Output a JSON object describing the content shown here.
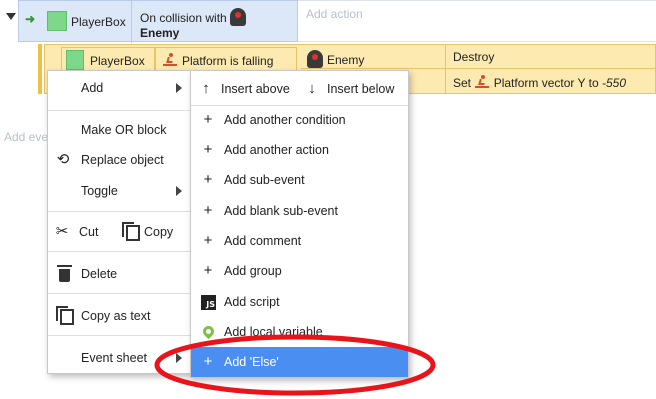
{
  "event": {
    "object": "PlayerBox",
    "condition_line1": "On collision with",
    "condition_line2": "Enemy",
    "add_action": "Add action"
  },
  "sub_event": {
    "object": "PlayerBox",
    "condition": "Platform is falling",
    "actions": [
      {
        "object": "Enemy",
        "action": "Destroy"
      },
      {
        "object": "",
        "action_prefix": "Set",
        "action_main": "Platform vector Y to",
        "action_value": "-550"
      }
    ]
  },
  "add_event": "Add eve",
  "context_menu": {
    "items": [
      {
        "label": "Add",
        "has_submenu": true
      },
      {
        "label": "Make OR block"
      },
      {
        "label": "Replace object",
        "icon": "replace-icon"
      },
      {
        "label": "Toggle",
        "has_submenu": true
      },
      {
        "label": "Cut",
        "icon": "scissors-icon"
      },
      {
        "label": "Copy",
        "icon": "copy-icon"
      },
      {
        "label": "Delete",
        "icon": "trash-icon"
      },
      {
        "label": "Copy as text",
        "icon": "copy-icon"
      },
      {
        "label": "Event sheet",
        "has_submenu": true
      }
    ]
  },
  "add_submenu": {
    "insert_above": "Insert above",
    "insert_below": "Insert below",
    "items": [
      "Add another condition",
      "Add another action",
      "Add sub-event",
      "Add blank sub-event",
      "Add comment",
      "Add group",
      "Add script",
      "Add local variable",
      "Add 'Else'"
    ],
    "highlighted": "Add 'Else'"
  },
  "colors": {
    "highlight": "#4b8ef1",
    "annotation_ellipse": "#e8141a",
    "event_condition_bg": "#dce8f7",
    "sub_event_bg": "#fdeab0"
  },
  "icons": {
    "plus": "+",
    "arrow_up": "↑",
    "arrow_down": "↓",
    "js_badge": "JS"
  }
}
